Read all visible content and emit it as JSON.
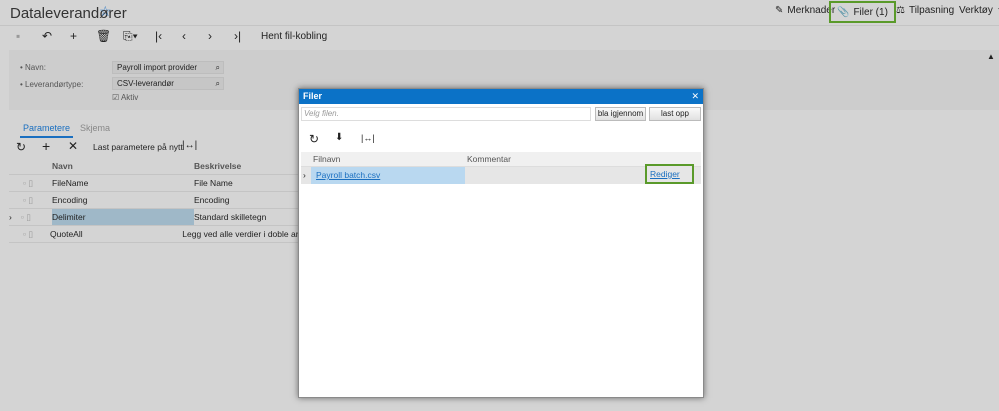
{
  "header": {
    "title": "Dataleverandører",
    "merknader": "Merknader",
    "filer": "Filer (1)",
    "tilpasning": "Tilpasning",
    "verktoy": "Verktøy"
  },
  "toolbar": {
    "hent": "Hent fil-kobling"
  },
  "form": {
    "navn_label": "Navn:",
    "navn_value": "Payroll import provider",
    "type_label": "Leverandørtype:",
    "type_value": "CSV-leverandør",
    "aktiv_label": "Aktiv"
  },
  "tabs": [
    "Parametere",
    "Skjema"
  ],
  "grid": {
    "reload_label": "Last parametere på nytt",
    "col_navn": "Navn",
    "col_beskrivelse": "Beskrivelse",
    "rows": [
      {
        "navn": "FileName",
        "beskrivelse": "File Name"
      },
      {
        "navn": "Encoding",
        "beskrivelse": "Encoding"
      },
      {
        "navn": "Delimiter",
        "beskrivelse": "Standard skilletegn"
      },
      {
        "navn": "QuoteAll",
        "beskrivelse": "Legg ved alle verdier i doble anførs"
      }
    ]
  },
  "modal": {
    "title": "Filer",
    "placeholder": "Velg filen.",
    "browse": "bla igjennom",
    "upload": "last opp",
    "col_filnavn": "Filnavn",
    "col_kommentar": "Kommentar",
    "file": "Payroll batch.csv",
    "edit": "Rediger"
  }
}
